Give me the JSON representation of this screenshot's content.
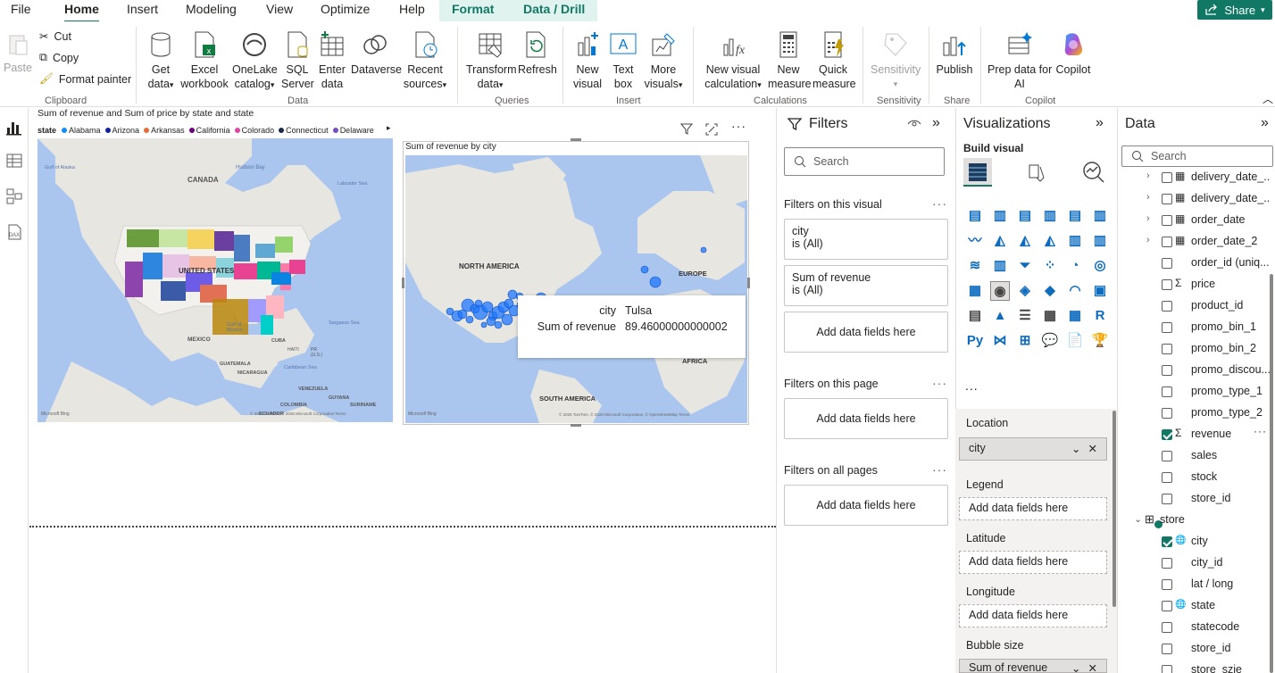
{
  "menu": {
    "file": "File",
    "home": "Home",
    "insert": "Insert",
    "modeling": "Modeling",
    "view": "View",
    "optimize": "Optimize",
    "help": "Help",
    "format": "Format",
    "data_drill": "Data / Drill",
    "share": "Share"
  },
  "ribbon": {
    "paste": "Paste",
    "cut": "Cut",
    "copy": "Copy",
    "format_painter": "Format painter",
    "clipboard": "Clipboard",
    "get_data": [
      "Get",
      "data"
    ],
    "excel": [
      "Excel",
      "workbook"
    ],
    "onelake": [
      "OneLake",
      "catalog"
    ],
    "sql": [
      "SQL",
      "Server"
    ],
    "enter": [
      "Enter",
      "data"
    ],
    "dataverse": "Dataverse",
    "recent": [
      "Recent",
      "sources"
    ],
    "data_group": "Data",
    "transform": [
      "Transform",
      "data"
    ],
    "refresh": "Refresh",
    "queries": "Queries",
    "new_visual": [
      "New",
      "visual"
    ],
    "text_box": [
      "Text",
      "box"
    ],
    "more_visuals": [
      "More",
      "visuals"
    ],
    "insert_group": "Insert",
    "new_visual_calc": [
      "New visual",
      "calculation"
    ],
    "new_measure": [
      "New",
      "measure"
    ],
    "quick_measure": [
      "Quick",
      "measure"
    ],
    "calculations": "Calculations",
    "sensitivity": "Sensitivity",
    "sensitivity_group": "Sensitivity",
    "publish": "Publish",
    "share_group": "Share",
    "prep_copilot": [
      "Prep data for",
      "AI"
    ],
    "copilot": "Copilot",
    "copilot_group": "Copilot"
  },
  "visual1": {
    "title": "Sum of revenue and Sum of price by state and state",
    "legend_label": "state",
    "legend": [
      {
        "name": "Alabama",
        "color": "#118dff"
      },
      {
        "name": "Arizona",
        "color": "#12239e"
      },
      {
        "name": "Arkansas",
        "color": "#e66c37"
      },
      {
        "name": "California",
        "color": "#6b007b"
      },
      {
        "name": "Colorado",
        "color": "#e044a7"
      },
      {
        "name": "Connecticut",
        "color": "#1a2b4a"
      },
      {
        "name": "Delaware",
        "color": "#744ec2"
      }
    ],
    "labels": {
      "canada": "CANADA",
      "us": "UNITED STATES",
      "mexico": "MEXICO",
      "gulf_alaska": "Gulf of Alaska",
      "hudson": "Hudson Bay",
      "labrador": "Labrador Sea",
      "sargasso": "Sargasso Sea",
      "gulf_mexico": "Gulf of Mexico",
      "cuba": "CUBA",
      "haiti": "HAITI",
      "pr": "PR (U.S.)",
      "guatemala": "GUATEMALA",
      "nicaragua": "NICARAGUA",
      "caribbean": "Caribbean Sea",
      "venezuela": "VENEZUELA",
      "guyana": "GUYANA",
      "suriname": "SURINAME",
      "colombia": "COLOMBIA",
      "ecuador": "ECUADOR"
    },
    "bing": "Microsoft Bing",
    "copyright": "© 2025 TomTom, © 2025 Microsoft Corporation  Terms"
  },
  "visual2": {
    "title": "Sum of revenue by city",
    "labels": {
      "na": "NORTH AMERICA",
      "europe": "EUROPE",
      "africa": "AFRICA",
      "sa": "SOUTH AMERICA"
    },
    "bing": "Microsoft Bing",
    "copyright": "© 2025 TomTom, © 2025 Microsoft Corporation, © OpenStreetMap  Terms",
    "tooltip": {
      "k1": "city",
      "v1": "Tulsa",
      "k2": "Sum of revenue",
      "v2": "89.46000000000002"
    }
  },
  "filters": {
    "title": "Filters",
    "search": "Search",
    "on_visual": "Filters on this visual",
    "f1_name": "city",
    "f1_val": "is (All)",
    "f2_name": "Sum of revenue",
    "f2_val": "is (All)",
    "add": "Add data fields here",
    "on_page": "Filters on this page",
    "on_all": "Filters on all pages"
  },
  "viz": {
    "title": "Visualizations",
    "build": "Build visual",
    "more": "...",
    "location": "Location",
    "location_val": "city",
    "legend": "Legend",
    "latitude": "Latitude",
    "longitude": "Longitude",
    "bubble": "Bubble size",
    "bubble_val": "Sum of revenue",
    "add": "Add data fields here"
  },
  "data": {
    "title": "Data",
    "search": "Search",
    "rows": [
      {
        "label": "delivery_date_...",
        "type": "table",
        "chev": true,
        "checked": false
      },
      {
        "label": "delivery_date_...",
        "type": "table",
        "chev": true,
        "checked": false
      },
      {
        "label": "order_date",
        "type": "table",
        "chev": true,
        "checked": false
      },
      {
        "label": "order_date_2",
        "type": "table",
        "chev": true,
        "checked": false
      },
      {
        "label": "order_id (uniq...",
        "type": "none",
        "chev": false,
        "checked": false
      },
      {
        "label": "price",
        "type": "sigma",
        "chev": false,
        "checked": false
      },
      {
        "label": "product_id",
        "type": "none",
        "chev": false,
        "checked": false
      },
      {
        "label": "promo_bin_1",
        "type": "none",
        "chev": false,
        "checked": false
      },
      {
        "label": "promo_bin_2",
        "type": "none",
        "chev": false,
        "checked": false
      },
      {
        "label": "promo_discou...",
        "type": "none",
        "chev": false,
        "checked": false
      },
      {
        "label": "promo_type_1",
        "type": "none",
        "chev": false,
        "checked": false
      },
      {
        "label": "promo_type_2",
        "type": "none",
        "chev": false,
        "checked": false
      },
      {
        "label": "revenue",
        "type": "sigma",
        "chev": false,
        "checked": true
      },
      {
        "label": "sales",
        "type": "none",
        "chev": false,
        "checked": false
      },
      {
        "label": "stock",
        "type": "none",
        "chev": false,
        "checked": false
      },
      {
        "label": "store_id",
        "type": "none",
        "chev": false,
        "checked": false
      },
      {
        "label": "store",
        "type": "storetable",
        "chev": false,
        "checked": false
      },
      {
        "label": "city",
        "type": "globe",
        "chev": false,
        "checked": true
      },
      {
        "label": "city_id",
        "type": "none",
        "chev": false,
        "checked": false
      },
      {
        "label": "lat / long",
        "type": "none",
        "chev": false,
        "checked": false
      },
      {
        "label": "state",
        "type": "globe",
        "chev": false,
        "checked": false
      },
      {
        "label": "statecode",
        "type": "none",
        "chev": false,
        "checked": false
      },
      {
        "label": "store_id",
        "type": "none",
        "chev": false,
        "checked": false
      },
      {
        "label": "store_szie",
        "type": "none",
        "chev": false,
        "checked": false
      }
    ]
  }
}
